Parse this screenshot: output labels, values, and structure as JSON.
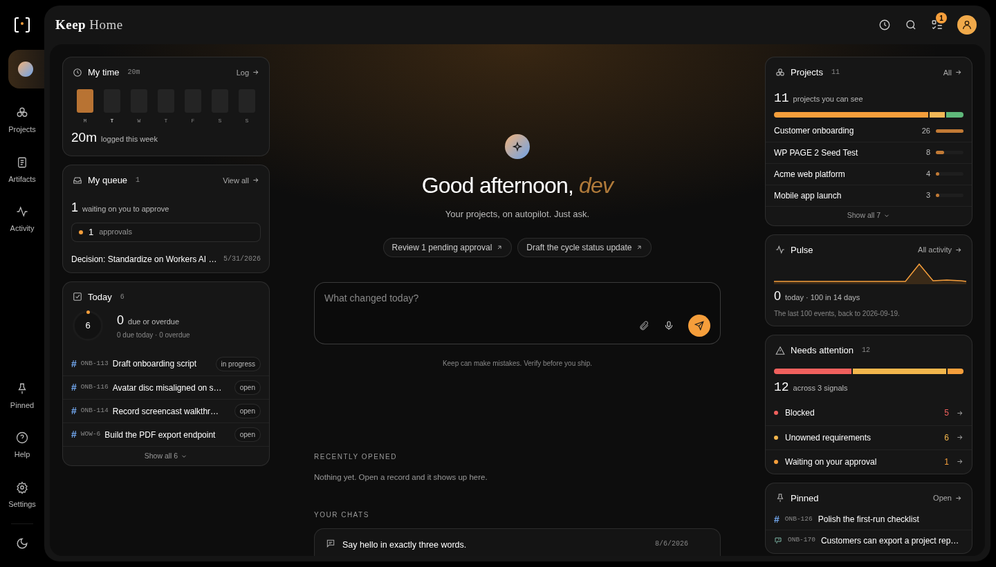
{
  "sidebar": {
    "home": {
      "selected": true
    },
    "nav": [
      {
        "label": "Projects",
        "selected": false
      },
      {
        "label": "Artifacts",
        "selected": false
      },
      {
        "label": "Activity",
        "selected": false
      }
    ],
    "bottom": [
      {
        "label": "Pinned",
        "selected": false
      },
      {
        "label": "Help",
        "selected": false
      },
      {
        "label": "Settings",
        "selected": false
      }
    ]
  },
  "header": {
    "brand": "Keep",
    "title": "Home",
    "notifications": "1"
  },
  "my_time": {
    "title": "My time",
    "badge": "20m",
    "link": "Log",
    "total": "20m",
    "total_label": "logged this week",
    "days": [
      {
        "label": "M",
        "logged": true,
        "today": false
      },
      {
        "label": "T",
        "logged": false,
        "today": true
      },
      {
        "label": "W",
        "logged": false,
        "today": false
      },
      {
        "label": "T",
        "logged": false,
        "today": false
      },
      {
        "label": "F",
        "logged": false,
        "today": false
      },
      {
        "label": "S",
        "logged": false,
        "today": false
      },
      {
        "label": "S",
        "logged": false,
        "today": false
      }
    ]
  },
  "queue": {
    "title": "My queue",
    "count": "1",
    "link": "View all",
    "total": "1",
    "total_label": "waiting on you to approve",
    "groups": [
      {
        "count": "1",
        "label": "approvals",
        "color": "#f59e3b"
      }
    ],
    "items": [
      {
        "title": "Decision: Standardize on Workers AI …",
        "date": "5/31/2026"
      }
    ]
  },
  "today": {
    "title": "Today",
    "count": "6",
    "ring_value": "6",
    "due": "0",
    "due_label": "due or overdue",
    "due_detail": "0 due today · 0 overdue",
    "tasks": [
      {
        "marker": "#",
        "id": "ONB-113",
        "title": "Draft onboarding script",
        "status": "in progress"
      },
      {
        "marker": "#",
        "id": "ONB-116",
        "title": "Avatar disc misaligned on s…",
        "status": "open"
      },
      {
        "marker": "#",
        "id": "ONB-114",
        "title": "Record screencast walkthr…",
        "status": "open"
      },
      {
        "marker": "#",
        "id": "WOW-6",
        "title": "Build the PDF export endpoint",
        "status": "open"
      }
    ],
    "show_all": "Show all 6"
  },
  "assistant": {
    "greeting": "Good afternoon,",
    "name": "dev",
    "subtitle": "Your projects, on autopilot. Just ask.",
    "suggestions": [
      "Review 1 pending approval",
      "Draft the cycle status update"
    ],
    "input": {
      "placeholder": "What changed today?"
    },
    "disclaimer": "Keep can make mistakes. Verify before you ship."
  },
  "recent": {
    "heading": "RECENTLY OPENED",
    "empty": "Nothing yet. Open a record and it shows up here."
  },
  "chats": {
    "heading": "YOUR CHATS",
    "items": [
      {
        "title": "Say hello in exactly three words.",
        "date": "8/6/2026"
      }
    ]
  },
  "projects": {
    "title": "Projects",
    "count": "11",
    "link": "All",
    "total": "11",
    "total_label": "projects you can see",
    "segments": [
      {
        "color": "#f59e3b"
      },
      {
        "color": "#f2b756"
      },
      {
        "color": "#5fb87a"
      }
    ],
    "items": [
      {
        "name": "Customer onboarding",
        "count": "26",
        "level": 1
      },
      {
        "name": "WP PAGE 2 Seed Test",
        "count": "8",
        "level": 0.3
      },
      {
        "name": "Acme web platform",
        "count": "4",
        "level": 0.1
      },
      {
        "name": "Mobile app launch",
        "count": "3",
        "level": 0.08
      }
    ],
    "show_all": "Show all 7"
  },
  "pulse": {
    "title": "Pulse",
    "link": "All activity",
    "today": "0",
    "summary": "today · 100 in 14 days",
    "note": "The last 100 events, back to 2026-09-19."
  },
  "attention": {
    "title": "Needs attention",
    "count": "12",
    "total": "12",
    "total_label": "across 3 signals",
    "signals": [
      {
        "label": "Blocked",
        "count": "5",
        "color": "#f0605d"
      },
      {
        "label": "Unowned requirements",
        "count": "6",
        "color": "#f2b64c"
      },
      {
        "label": "Waiting on your approval",
        "count": "1",
        "color": "#f59e3b"
      }
    ]
  },
  "pinned": {
    "title": "Pinned",
    "link": "Open",
    "items": [
      {
        "kind": "task",
        "marker": "#",
        "id": "ONB-126",
        "title": "Polish the first-run checklist"
      },
      {
        "kind": "requirement",
        "id": "ONB-170",
        "title": "Customers can export a project rep…"
      }
    ]
  }
}
